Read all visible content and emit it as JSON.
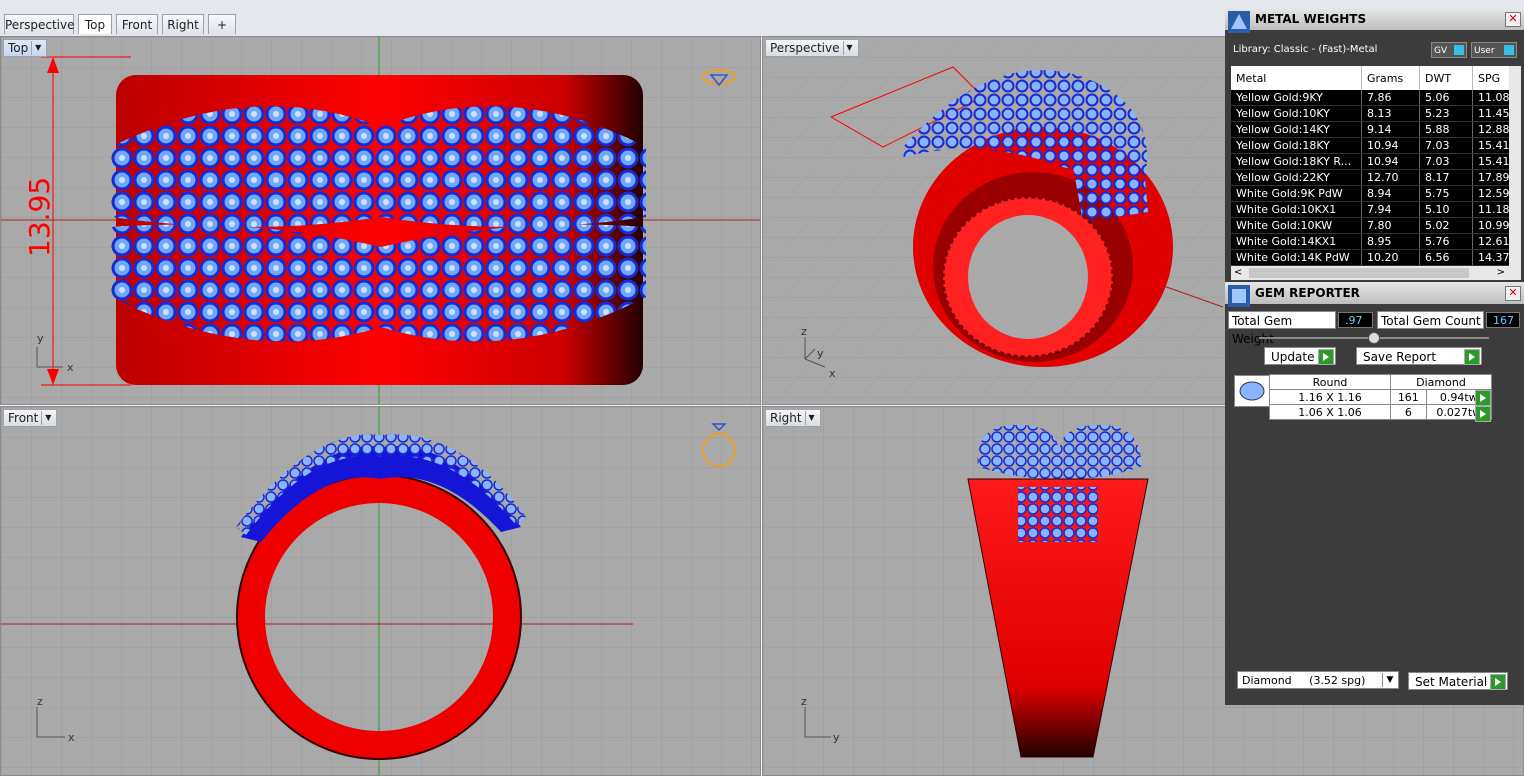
{
  "tabs": [
    "Perspective",
    "Top",
    "Front",
    "Right",
    "+"
  ],
  "active_tab": "Top",
  "viewports": {
    "top": {
      "label": "Top",
      "dimension": "13.95",
      "axis_y": "y",
      "axis_x": "x"
    },
    "perspective": {
      "label": "Perspective",
      "axis_z": "z",
      "axis_y": "y",
      "axis_x": "x"
    },
    "front": {
      "label": "Front",
      "axis_z": "z",
      "axis_x": "x"
    },
    "right": {
      "label": "Right",
      "axis_z": "z",
      "axis_y": "y"
    }
  },
  "metal_weights": {
    "title": "METAL WEIGHTS",
    "library": "Library: Classic - (Fast)-Metal",
    "toggle_gv": "GV",
    "toggle_user": "User",
    "columns": [
      "Metal",
      "Grams",
      "DWT",
      "SPG"
    ],
    "rows": [
      [
        "Yellow Gold:9KY",
        "7.86",
        "5.06",
        "11.08"
      ],
      [
        "Yellow Gold:10KY",
        "8.13",
        "5.23",
        "11.45"
      ],
      [
        "Yellow Gold:14KY",
        "9.14",
        "5.88",
        "12.88"
      ],
      [
        "Yellow Gold:18KY",
        "10.94",
        "7.03",
        "15.41"
      ],
      [
        "Yellow Gold:18KY R...",
        "10.94",
        "7.03",
        "15.41"
      ],
      [
        "Yellow Gold:22KY",
        "12.70",
        "8.17",
        "17.89"
      ],
      [
        "White Gold:9K PdW",
        "8.94",
        "5.75",
        "12.59"
      ],
      [
        "White Gold:10KX1",
        "7.94",
        "5.10",
        "11.18"
      ],
      [
        "White Gold:10KW",
        "7.80",
        "5.02",
        "10.99"
      ],
      [
        "White Gold:14KX1",
        "8.95",
        "5.76",
        "12.61"
      ],
      [
        "White Gold:14K PdW",
        "10.20",
        "6.56",
        "14.37"
      ]
    ]
  },
  "gem_reporter": {
    "title": "GEM REPORTER",
    "total_weight_label": "Total Gem Weight",
    "total_weight": ".97",
    "total_count_label": "Total Gem Count",
    "total_count": "167",
    "update_label": "Update",
    "save_label": "Save Report",
    "gem_headers": [
      "Round",
      "Diamond"
    ],
    "gem_rows": [
      [
        "1.16 X 1.16",
        "161",
        "0.94tw"
      ],
      [
        "1.06 X 1.06",
        "6",
        "0.027tw"
      ]
    ],
    "material_select": "Diamond     (3.52 spg)",
    "set_material_label": "Set Material"
  },
  "colors": {
    "metal": "#ff0000",
    "gems": "#1010d0",
    "grid_bg": "#a9a9a9",
    "panel_bg": "#3c3c3c"
  }
}
